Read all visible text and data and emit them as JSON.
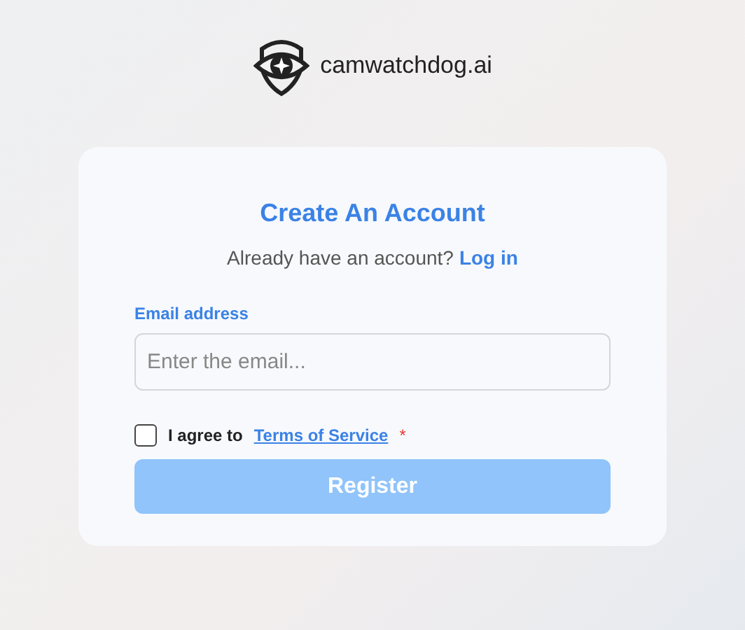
{
  "brand": {
    "name": "camwatchdog.ai"
  },
  "form": {
    "title": "Create An Account",
    "login_prompt": {
      "text": "Already have an account?",
      "link": "Log in"
    },
    "email": {
      "label": "Email address",
      "placeholder": "Enter the email..."
    },
    "terms": {
      "checked": false,
      "text": "I agree to",
      "link": "Terms of Service",
      "required_mark": "*"
    },
    "register": {
      "label": "Register",
      "disabled": true
    }
  }
}
